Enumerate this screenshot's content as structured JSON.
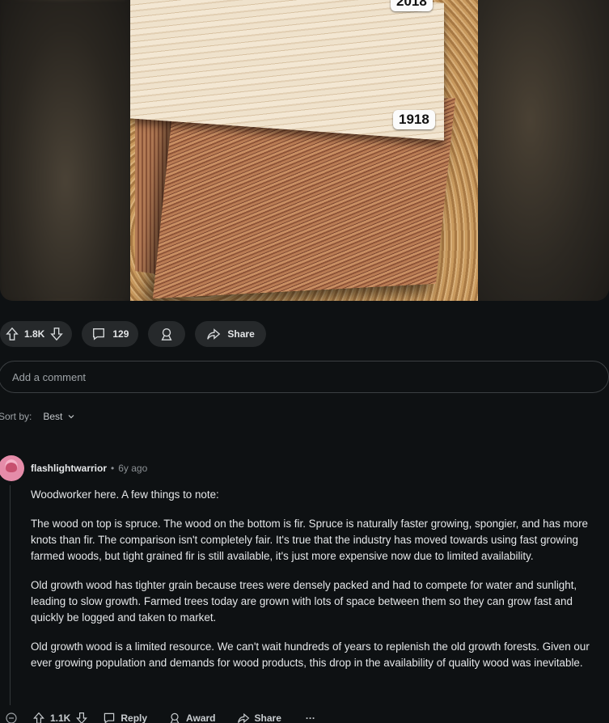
{
  "media": {
    "tag_top": "2018",
    "tag_bottom": "1918"
  },
  "post_actions": {
    "vote_count": "1.8K",
    "comment_count": "129",
    "share_label": "Share"
  },
  "comment_input": {
    "placeholder": "Add a comment"
  },
  "sort": {
    "label": "Sort by:",
    "value": "Best"
  },
  "comment": {
    "author": "flashlightwarrior",
    "separator": "•",
    "time": "6y ago",
    "paragraphs": [
      "Woodworker here. A few things to note:",
      "The wood on top is spruce. The wood on the bottom is fir. Spruce is naturally faster growing, spongier, and has more knots than fir. The comparison isn't completely fair. It's true that the industry has moved towards using fast growing farmed woods, but tight grained fir is still available, it's just more expensive now due to limited availability.",
      "Old growth wood has tighter grain because trees were densely packed and had to compete for water and sunlight, leading to slow growth. Farmed trees today are grown with lots of space between them so they can grow fast and quickly be logged and taken to market.",
      "Old growth wood is a limited resource. We can't wait hundreds of years to replenish the old growth forests. Given our ever growing population and demands for wood products, this drop in the availability of quality wood was inevitable."
    ],
    "actions": {
      "vote_count": "1.1K",
      "reply_label": "Reply",
      "award_label": "Award",
      "share_label": "Share",
      "more_label": "···"
    }
  }
}
